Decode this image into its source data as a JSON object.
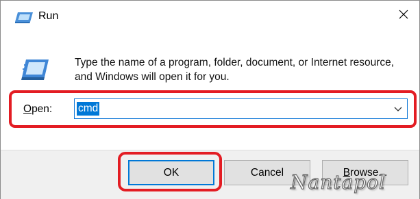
{
  "window": {
    "title": "Run",
    "icon": "run-icon",
    "close_icon": "close-icon"
  },
  "dialog": {
    "icon": "run-icon",
    "message": "Type the name of a program, folder, document, or Internet resource, and Windows will open it for you.",
    "open_label_access_key": "O",
    "open_label_rest": "pen:",
    "open_value": "cmd",
    "dropdown_icon": "chevron-down-icon"
  },
  "buttons": {
    "ok": "OK",
    "cancel": "Cancel",
    "browse_access_key": "B",
    "browse_rest": "rowse..."
  },
  "watermark": "Nantapol",
  "colors": {
    "highlight": "#e31c23",
    "selection": "#0078d7",
    "footer_bg": "#f0f0f0"
  }
}
